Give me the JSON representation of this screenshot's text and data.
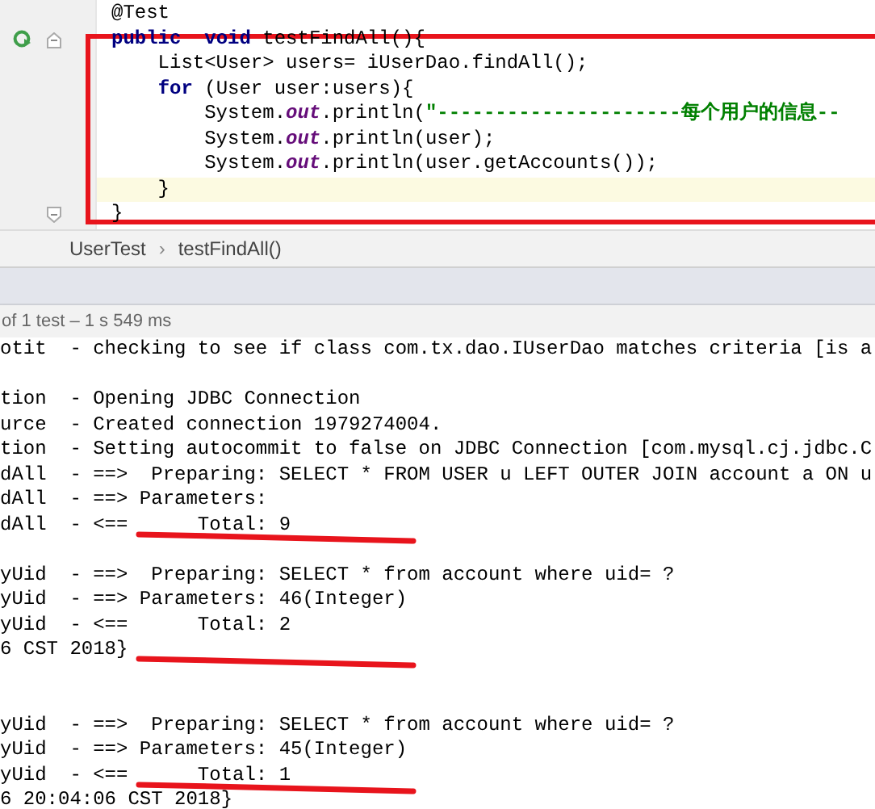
{
  "editor": {
    "annotated": true,
    "lines": [
      {
        "code": "@Test",
        "runnable": false,
        "foldable": false,
        "current": false
      },
      {
        "code": "**public**  **void** testFindAll(){",
        "runnable": true,
        "foldable": true,
        "current": false
      },
      {
        "code": "    List<User> users= iUserDao.findAll();",
        "runnable": false,
        "foldable": false,
        "current": false
      },
      {
        "code": "    **for** (User user:users){",
        "runnable": false,
        "foldable": false,
        "current": false
      },
      {
        "code": "        System.*out*.println(",
        "literal": "\"---------------------每个用户的信息--",
        "runnable": false,
        "foldable": false,
        "current": false
      },
      {
        "code": "        System.*out*.println(user);",
        "runnable": false,
        "foldable": false,
        "current": false
      },
      {
        "code": "        System.*out*.println(user.getAccounts());",
        "runnable": false,
        "foldable": false,
        "current": false
      },
      {
        "code": "    }",
        "runnable": false,
        "foldable": false,
        "current": true
      },
      {
        "code": "}",
        "runnable": false,
        "foldable": true,
        "current": false
      }
    ]
  },
  "breadcrumb": {
    "items": [
      "UserTest",
      "testFindAll()"
    ],
    "separator": "›"
  },
  "status": "of 1 test – 1 s 549 ms",
  "console": [
    {
      "text": "otit  - checking to see if class com.tx.dao.IUserDao matches criteria [is a",
      "underlined": false
    },
    {
      "underlined": false
    },
    {
      "text": "tion  - Opening JDBC Connection",
      "underlined": false
    },
    {
      "text": "urce  - Created connection 1979274004.",
      "underlined": false
    },
    {
      "text": "tion  - Setting autocommit to false on JDBC Connection [com.mysql.cj.jdbc.C",
      "underlined": false
    },
    {
      "text": "dAll  - ==>  Preparing: SELECT * FROM USER u LEFT OUTER JOIN account a ON u",
      "underlined": false
    },
    {
      "text": "dAll  - ==> Parameters:",
      "underlined": false
    },
    {
      "text": "dAll  - <==      Total: 9",
      "underlined": true
    },
    {
      "underlined": false
    },
    {
      "text": "yUid  - ==>  Preparing: SELECT * from account where uid= ?",
      "underlined": false
    },
    {
      "text": "yUid  - ==> Parameters: 46(Integer)",
      "underlined": false
    },
    {
      "text": "yUid  - <==      Total: 2",
      "underlined": false
    },
    {
      "text": "6 CST 2018}",
      "underlined": true
    },
    {
      "underlined": false
    },
    {
      "underlined": false
    },
    {
      "text": "yUid  - ==>  Preparing: SELECT * from account where uid= ?",
      "underlined": false
    },
    {
      "text": "yUid  - ==> Parameters: 45(Integer)",
      "underlined": false
    },
    {
      "text": "yUid  - <==      Total: 1",
      "underlined": true
    },
    {
      "text": "6 20:04:06 CST 2018}",
      "underlined": false
    }
  ]
}
